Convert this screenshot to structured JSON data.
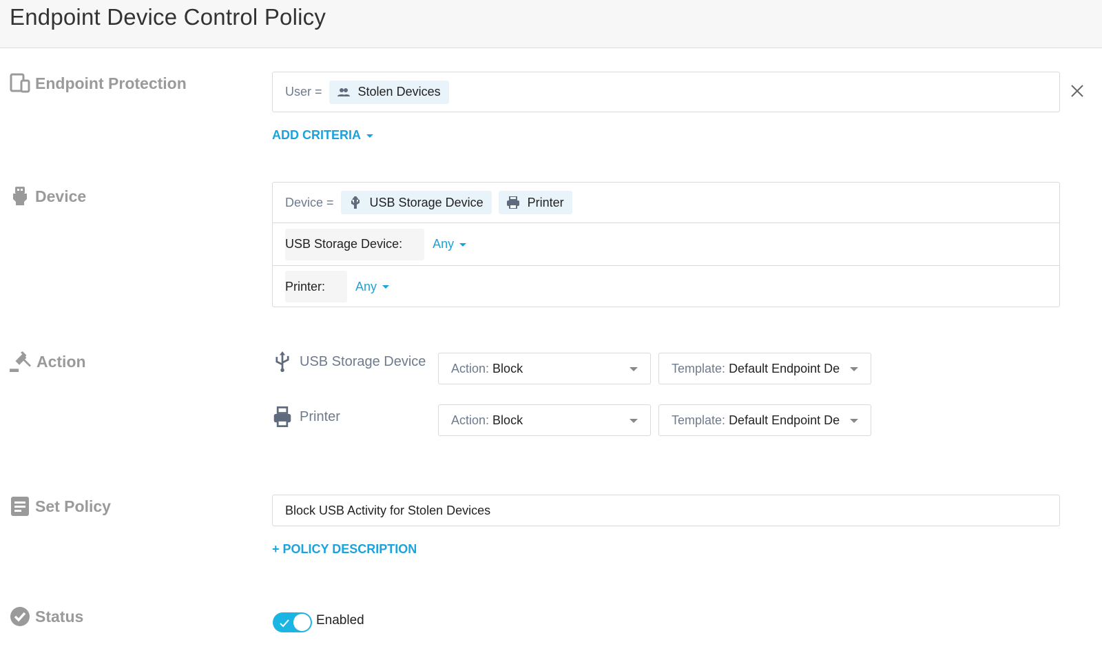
{
  "header": {
    "title": "Endpoint Device Control Policy"
  },
  "sections": {
    "endpoint": {
      "label": "Endpoint Protection",
      "icon": "devices-icon"
    },
    "device": {
      "label": "Device",
      "icon": "usb-drive-icon"
    },
    "action": {
      "label": "Action",
      "icon": "gavel-icon"
    },
    "policy": {
      "label": "Set Policy",
      "icon": "document-icon"
    },
    "status": {
      "label": "Status",
      "icon": "check-circle-icon"
    }
  },
  "criteria": {
    "prefix": "User =",
    "chip": "Stolen Devices",
    "add": "ADD CRITERIA"
  },
  "device": {
    "prefix": "Device =",
    "chips": [
      "USB Storage Device",
      "Printer"
    ],
    "rows": [
      {
        "label": "USB Storage Device:",
        "value": "Any"
      },
      {
        "label": "Printer:",
        "value": "Any"
      }
    ]
  },
  "actions": [
    {
      "device": "USB Storage Device",
      "action_label": "Action:",
      "action": "Block",
      "template_label": "Template:",
      "template": "Default Endpoint De"
    },
    {
      "device": "Printer",
      "action_label": "Action:",
      "action": "Block",
      "template_label": "Template:",
      "template": "Default Endpoint De"
    }
  ],
  "policy": {
    "name": "Block USB Activity for Stolen Devices",
    "add_description": "+ POLICY DESCRIPTION"
  },
  "status": {
    "label": "Enabled",
    "enabled": true
  },
  "colors": {
    "accent": "#1aa3dc",
    "section_label": "#9a9a9a",
    "chip_bg": "#e8f4fa"
  }
}
